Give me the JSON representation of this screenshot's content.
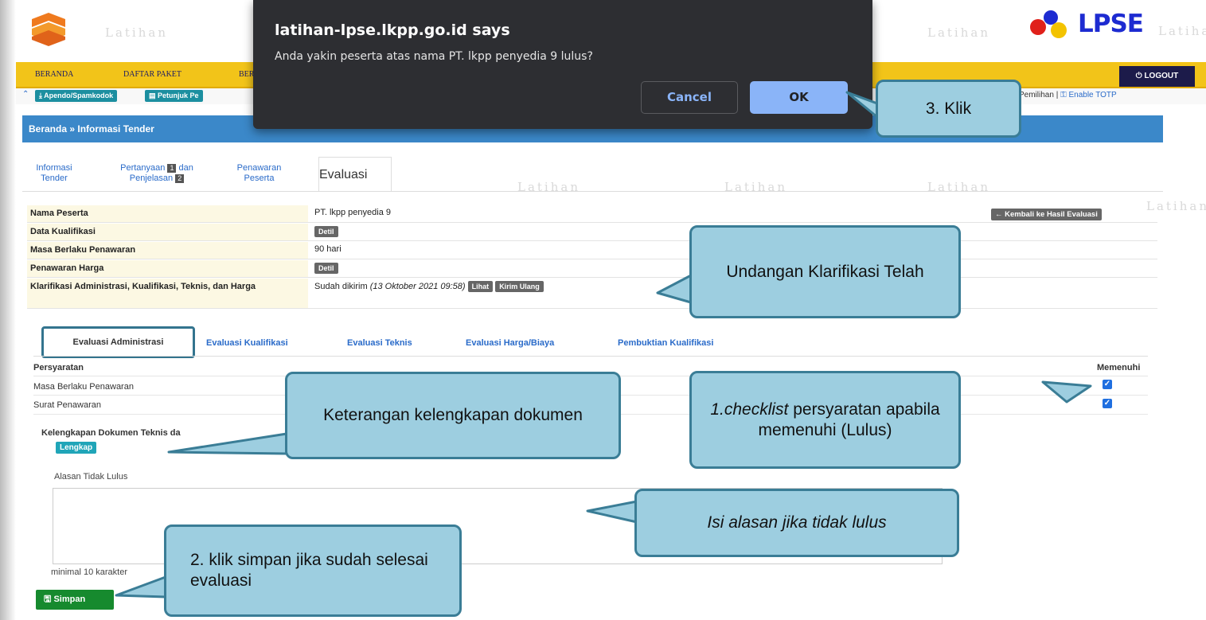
{
  "watermark": "Latihan",
  "brand": {
    "lpse_text": "LPSE"
  },
  "nav": {
    "items": [
      "BERANDA",
      "DAFTAR PAKET",
      "BER"
    ],
    "logout": "LOGOUT"
  },
  "toolbar": {
    "apendo": "Apendo/Spamkodok",
    "petunjuk": "Petunjuk Pe",
    "right_text": "Pemilihan | ",
    "enable_totp": "Enable TOTP"
  },
  "breadcrumb": "Beranda » Informasi Tender",
  "tabs": {
    "informasi": [
      "Informasi",
      "Tender"
    ],
    "pertanyaan_a": "Pertanyaan",
    "pertanyaan_num1": "1",
    "pertanyaan_b": "dan",
    "penjelasan": "Penjelasan",
    "penjelasan_num": "2",
    "penawaran": [
      "Penawaran",
      "Peserta"
    ],
    "evaluasi": "Evaluasi"
  },
  "info": {
    "nama_label": "Nama Peserta",
    "nama_value": "PT. lkpp penyedia 9",
    "back_button": "Kembali ke Hasil Evaluasi",
    "kualifikasi_label": "Data Kualifikasi",
    "detil": "Detil",
    "masa_label": "Masa Berlaku Penawaran",
    "masa_value": "90 hari",
    "harga_label": "Penawaran Harga",
    "klarifikasi_label": "Klarifikasi Administrasi, Kualifikasi, Teknis, dan Harga",
    "klarifikasi_value": "Sudah dikirim",
    "klarifikasi_date": "(13 Oktober 2021 09:58)",
    "lihat": "Lihat",
    "kirim_ulang": "Kirim Ulang"
  },
  "eval_tabs": [
    "Evaluasi Administrasi",
    "Evaluasi Kualifikasi",
    "Evaluasi Teknis",
    "Evaluasi Harga/Biaya",
    "Pembuktian Kualifikasi"
  ],
  "requirements": {
    "head_left": "Persyaratan",
    "head_right": "Memenuhi",
    "rows": [
      {
        "label": "Masa Berlaku Penawaran",
        "checked": true
      },
      {
        "label": "Surat Penawaran",
        "checked": true
      }
    ]
  },
  "kelengkapan": {
    "label": "Kelengkapan Dokumen Teknis da",
    "status": "Lengkap"
  },
  "alasan": {
    "label": "Alasan Tidak Lulus",
    "value": "",
    "hint": "minimal 10 karakter"
  },
  "simpan": "Simpan",
  "dialog": {
    "title": "latihan-lpse.lkpp.go.id says",
    "message": "Anda yakin peserta atas nama PT. lkpp penyedia 9 lulus?",
    "cancel": "Cancel",
    "ok": "OK"
  },
  "callouts": {
    "klik": "3. Klik",
    "undangan": "Undangan Klarifikasi Telah",
    "keterangan": "Keterangan kelengkapan dokumen",
    "checklist_em": "1.checklist",
    "checklist_rest": " persyaratan apabila memenuhi (Lulus)",
    "isi_alasan": "Isi alasan jika tidak lulus",
    "simpan_note": "2. klik simpan jika sudah selesai evaluasi"
  },
  "colors": {
    "nav_yellow": "#f2c419",
    "breadcrumb_blue": "#3b88c9",
    "callout_fill": "#9dcee0",
    "callout_border": "#3a7d96",
    "dialog_bg": "#2d2e32",
    "ok_blue": "#8ab4f8",
    "save_green": "#168a2e"
  }
}
